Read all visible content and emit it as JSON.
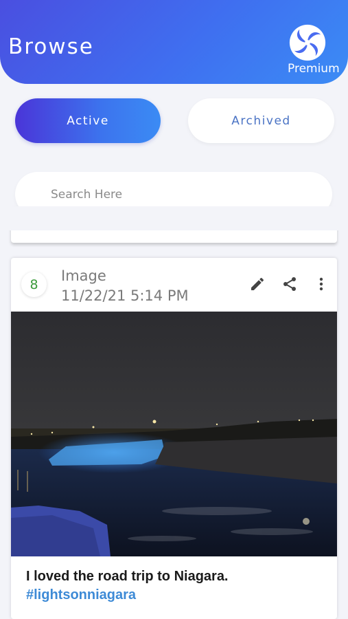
{
  "header": {
    "title": "Browse",
    "premium_label": "Premium"
  },
  "tabs": {
    "active_label": "Active",
    "archived_label": "Archived",
    "selected": "Active"
  },
  "search": {
    "placeholder": "Search Here",
    "value": ""
  },
  "card": {
    "badge_count": "8",
    "type_label": "Image",
    "timestamp": "11/22/21 5:14 PM",
    "actions": [
      "edit-icon",
      "share-icon",
      "more-vert-icon"
    ],
    "image_alt": "Niagara Falls illuminated in blue at night",
    "caption_text": "I loved the road trip to Niagara.",
    "hashtag": "#lightsonniagara"
  },
  "colors": {
    "accent": "#3f6ff0",
    "hashtag": "#3d8ad6",
    "badge": "#3a9a3a"
  }
}
